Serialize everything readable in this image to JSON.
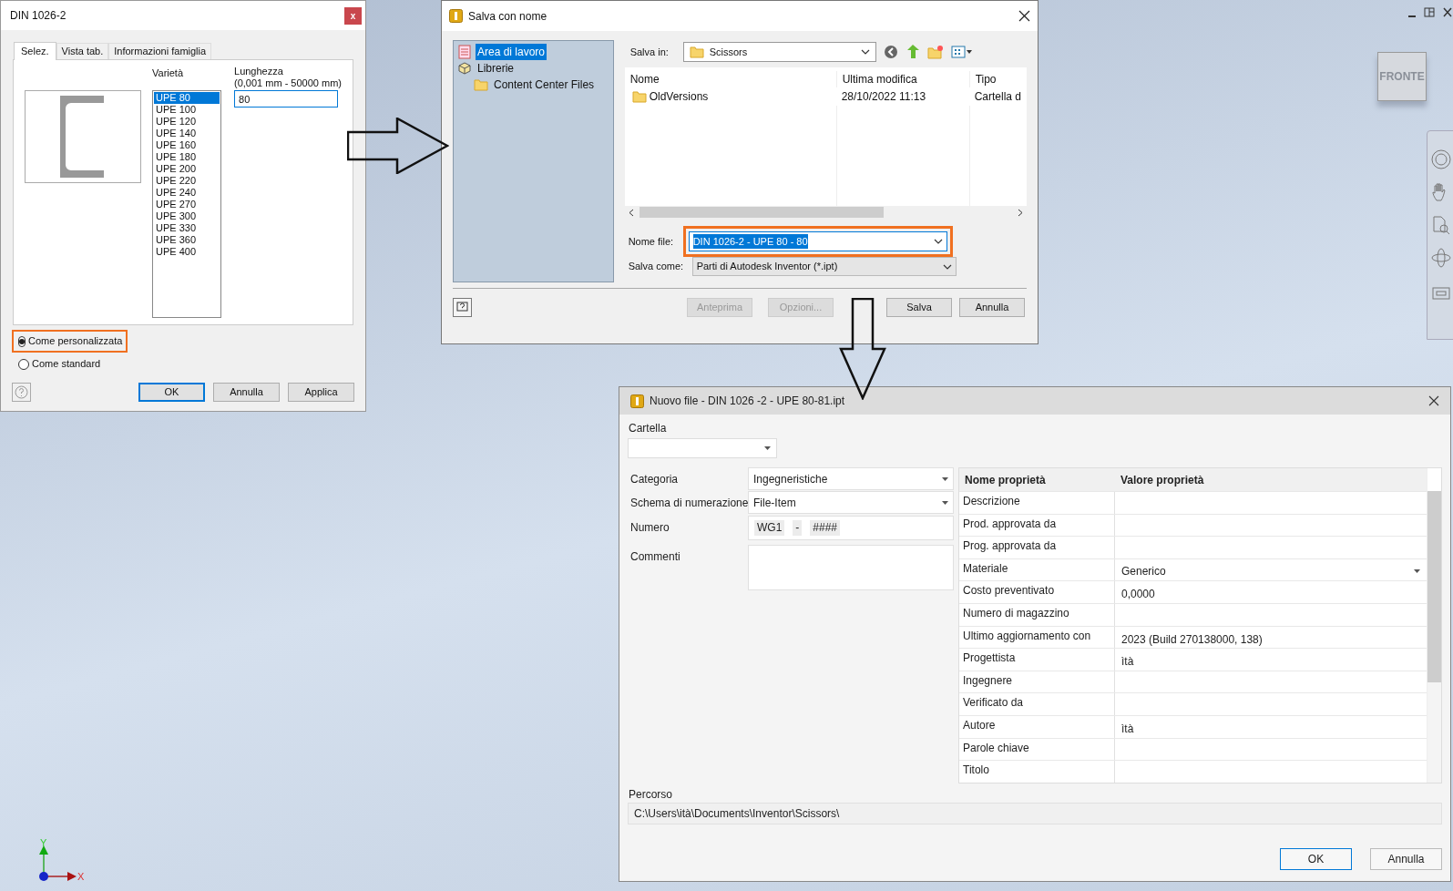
{
  "viewport": {
    "view_cube_label": "FRONTE",
    "axes": {
      "y": "Y",
      "x": "X"
    }
  },
  "din_dialog": {
    "title": "DIN 1026-2",
    "close": "x",
    "tabs": [
      {
        "label": "Selez.",
        "selected": true
      },
      {
        "label": "Vista tab.",
        "selected": false
      },
      {
        "label": "Informazioni famiglia",
        "selected": false
      }
    ],
    "variety_label": "Varietà",
    "length_label": "Lunghezza",
    "length_range": "(0,001 mm - 50000 mm)",
    "length_value": "80",
    "varieties": [
      {
        "label": "UPE 80",
        "selected": true
      },
      {
        "label": "UPE 100",
        "selected": false
      },
      {
        "label": "UPE 120",
        "selected": false
      },
      {
        "label": "UPE 140",
        "selected": false
      },
      {
        "label": "UPE 160",
        "selected": false
      },
      {
        "label": "UPE 180",
        "selected": false
      },
      {
        "label": "UPE 200",
        "selected": false
      },
      {
        "label": "UPE 220",
        "selected": false
      },
      {
        "label": "UPE 240",
        "selected": false
      },
      {
        "label": "UPE 270",
        "selected": false
      },
      {
        "label": "UPE 300",
        "selected": false
      },
      {
        "label": "UPE 330",
        "selected": false
      },
      {
        "label": "UPE 360",
        "selected": false
      },
      {
        "label": "UPE 400",
        "selected": false
      }
    ],
    "options": [
      {
        "label": "Come personalizzata",
        "selected": true,
        "highlighted": true
      },
      {
        "label": "Come standard",
        "selected": false,
        "highlighted": false
      }
    ],
    "buttons": [
      {
        "label": "OK",
        "default": true
      },
      {
        "label": "Annulla",
        "default": false
      },
      {
        "label": "Applica",
        "default": false
      }
    ]
  },
  "save_dialog": {
    "title": "Salva con nome",
    "places": [
      {
        "label": "Area di lavoro",
        "kind": "workspace",
        "selected": true
      },
      {
        "label": "Librerie",
        "kind": "library",
        "selected": false,
        "children": [
          {
            "label": "Content Center Files",
            "kind": "folder",
            "selected": false
          }
        ]
      }
    ],
    "save_in_label": "Salva in:",
    "save_in_value": "Scissors",
    "columns": [
      "Nome",
      "Ultima modifica",
      "Tipo"
    ],
    "rows": [
      {
        "cells": [
          "OldVersions",
          "28/10/2022 11:13",
          "Cartella d"
        ]
      }
    ],
    "file_name_label": "Nome file:",
    "file_name": {
      "value": "DIN 1026-2 - UPE 80 - 80",
      "highlighted": true
    },
    "save_as_label": "Salva come:",
    "save_as": "Parti di Autodesk Inventor (*.ipt)",
    "buttons": [
      {
        "label": "Anteprima",
        "disabled": true
      },
      {
        "label": "Opzioni...",
        "disabled": true
      },
      {
        "label": "Salva",
        "disabled": false
      },
      {
        "label": "Annulla",
        "disabled": false
      }
    ]
  },
  "new_file_dialog": {
    "title": "Nuovo file - DIN 1026 -2 - UPE 80-81.ipt",
    "folder_label": "Cartella",
    "fields": [
      {
        "label": "Categoria",
        "kind": "dropdown",
        "value": "Ingegneristiche"
      },
      {
        "label": "Schema di numerazione",
        "kind": "dropdown",
        "value": "File-Item"
      },
      {
        "label": "Numero",
        "kind": "number",
        "parts": [
          "WG1",
          "-",
          "####"
        ]
      },
      {
        "label": "Commenti",
        "kind": "textarea"
      }
    ],
    "property_columns": [
      "Nome proprietà",
      "Valore proprietà"
    ],
    "properties": [
      {
        "name": "Descrizione",
        "kind": "text"
      },
      {
        "name": "Prod. approvata da",
        "kind": "text"
      },
      {
        "name": "Prog. approvata da",
        "kind": "text"
      },
      {
        "name": "Materiale",
        "kind": "dropdown",
        "value": "Generico"
      },
      {
        "name": "Costo preventivato",
        "kind": "text",
        "value": "0,0000"
      },
      {
        "name": "Numero di magazzino",
        "kind": "text"
      },
      {
        "name": "Ultimo aggiornamento con",
        "kind": "text",
        "value": "2023 (Build 270138000, 138)"
      },
      {
        "name": "Progettista",
        "kind": "text",
        "value": "ìtà"
      },
      {
        "name": "Ingegnere",
        "kind": "text"
      },
      {
        "name": "Verificato da",
        "kind": "text"
      },
      {
        "name": "Autore",
        "kind": "text",
        "value": "ìtà"
      },
      {
        "name": "Parole chiave",
        "kind": "text"
      },
      {
        "name": "Titolo",
        "kind": "text"
      }
    ],
    "path_label": "Percorso",
    "path": "C:\\Users\\ità\\Documents\\Inventor\\Scissors\\",
    "buttons": [
      {
        "label": "OK",
        "default": true
      },
      {
        "label": "Annulla",
        "default": false
      }
    ]
  }
}
